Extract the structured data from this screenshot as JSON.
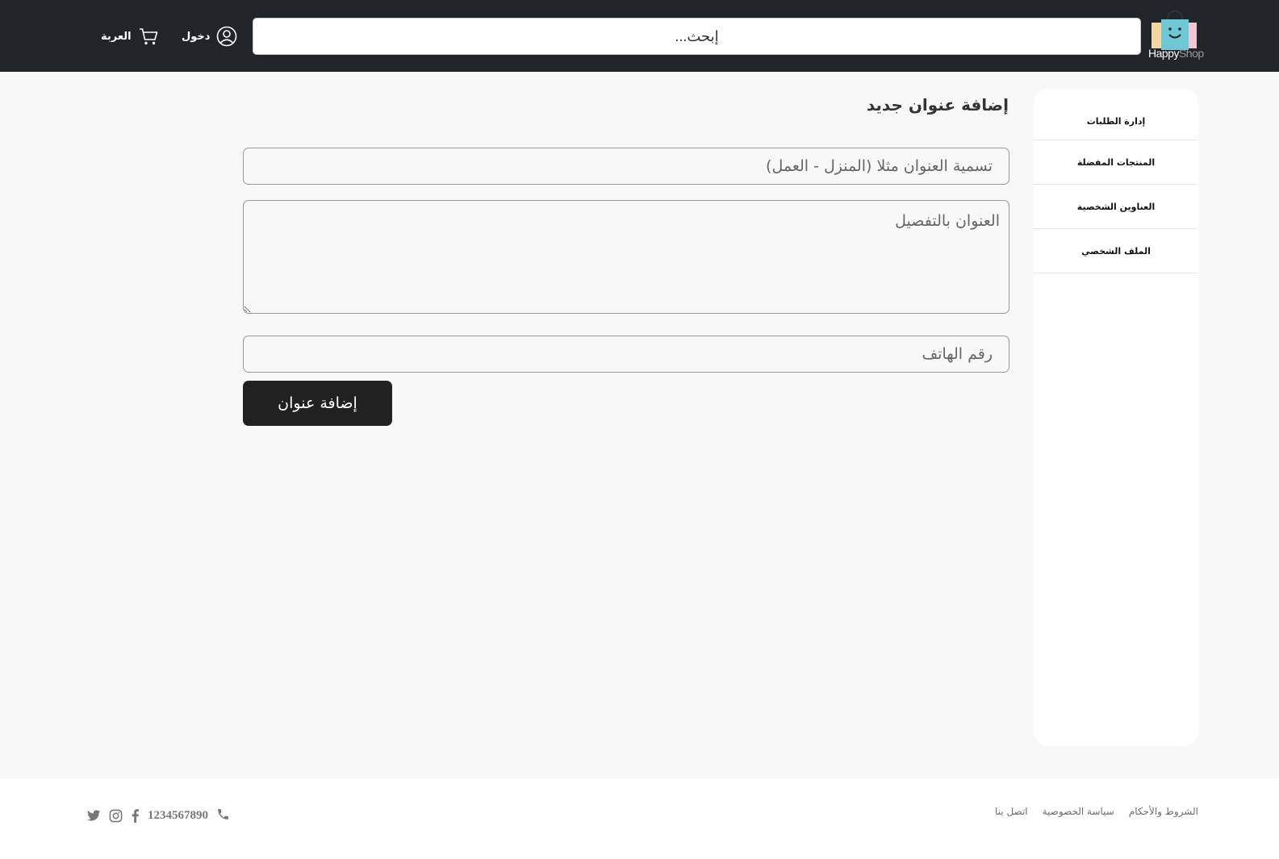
{
  "header": {
    "logo": {
      "word1": "Happy",
      "word2": "Shop"
    },
    "search_placeholder": "إبحث...",
    "login_label": "دخول",
    "cart_label": "العربة"
  },
  "sidebar": {
    "items": [
      {
        "label": "إدارة الطلبات"
      },
      {
        "label": "المنتجات المفضلة"
      },
      {
        "label": "العناوين الشخصية"
      },
      {
        "label": "الملف الشخصي"
      }
    ]
  },
  "form": {
    "title": "إضافة عنوان جديد",
    "label_placeholder": "تسمية العنوان مثلا (المنزل - العمل)",
    "address_placeholder": "العنوان بالتفصيل",
    "phone_placeholder": "رقم الهاتف",
    "submit_label": "إضافة عنوان"
  },
  "footer": {
    "links": [
      {
        "label": "الشروط والأحكام"
      },
      {
        "label": "سياسة الخصوصية"
      },
      {
        "label": "اتصل بنا"
      }
    ],
    "phone": "1234567890",
    "social": [
      "facebook-icon",
      "instagram-icon",
      "twitter-icon"
    ]
  },
  "colors": {
    "header_bg": "#212529",
    "page_bg": "#f8f8f8",
    "button_bg": "#212121"
  }
}
